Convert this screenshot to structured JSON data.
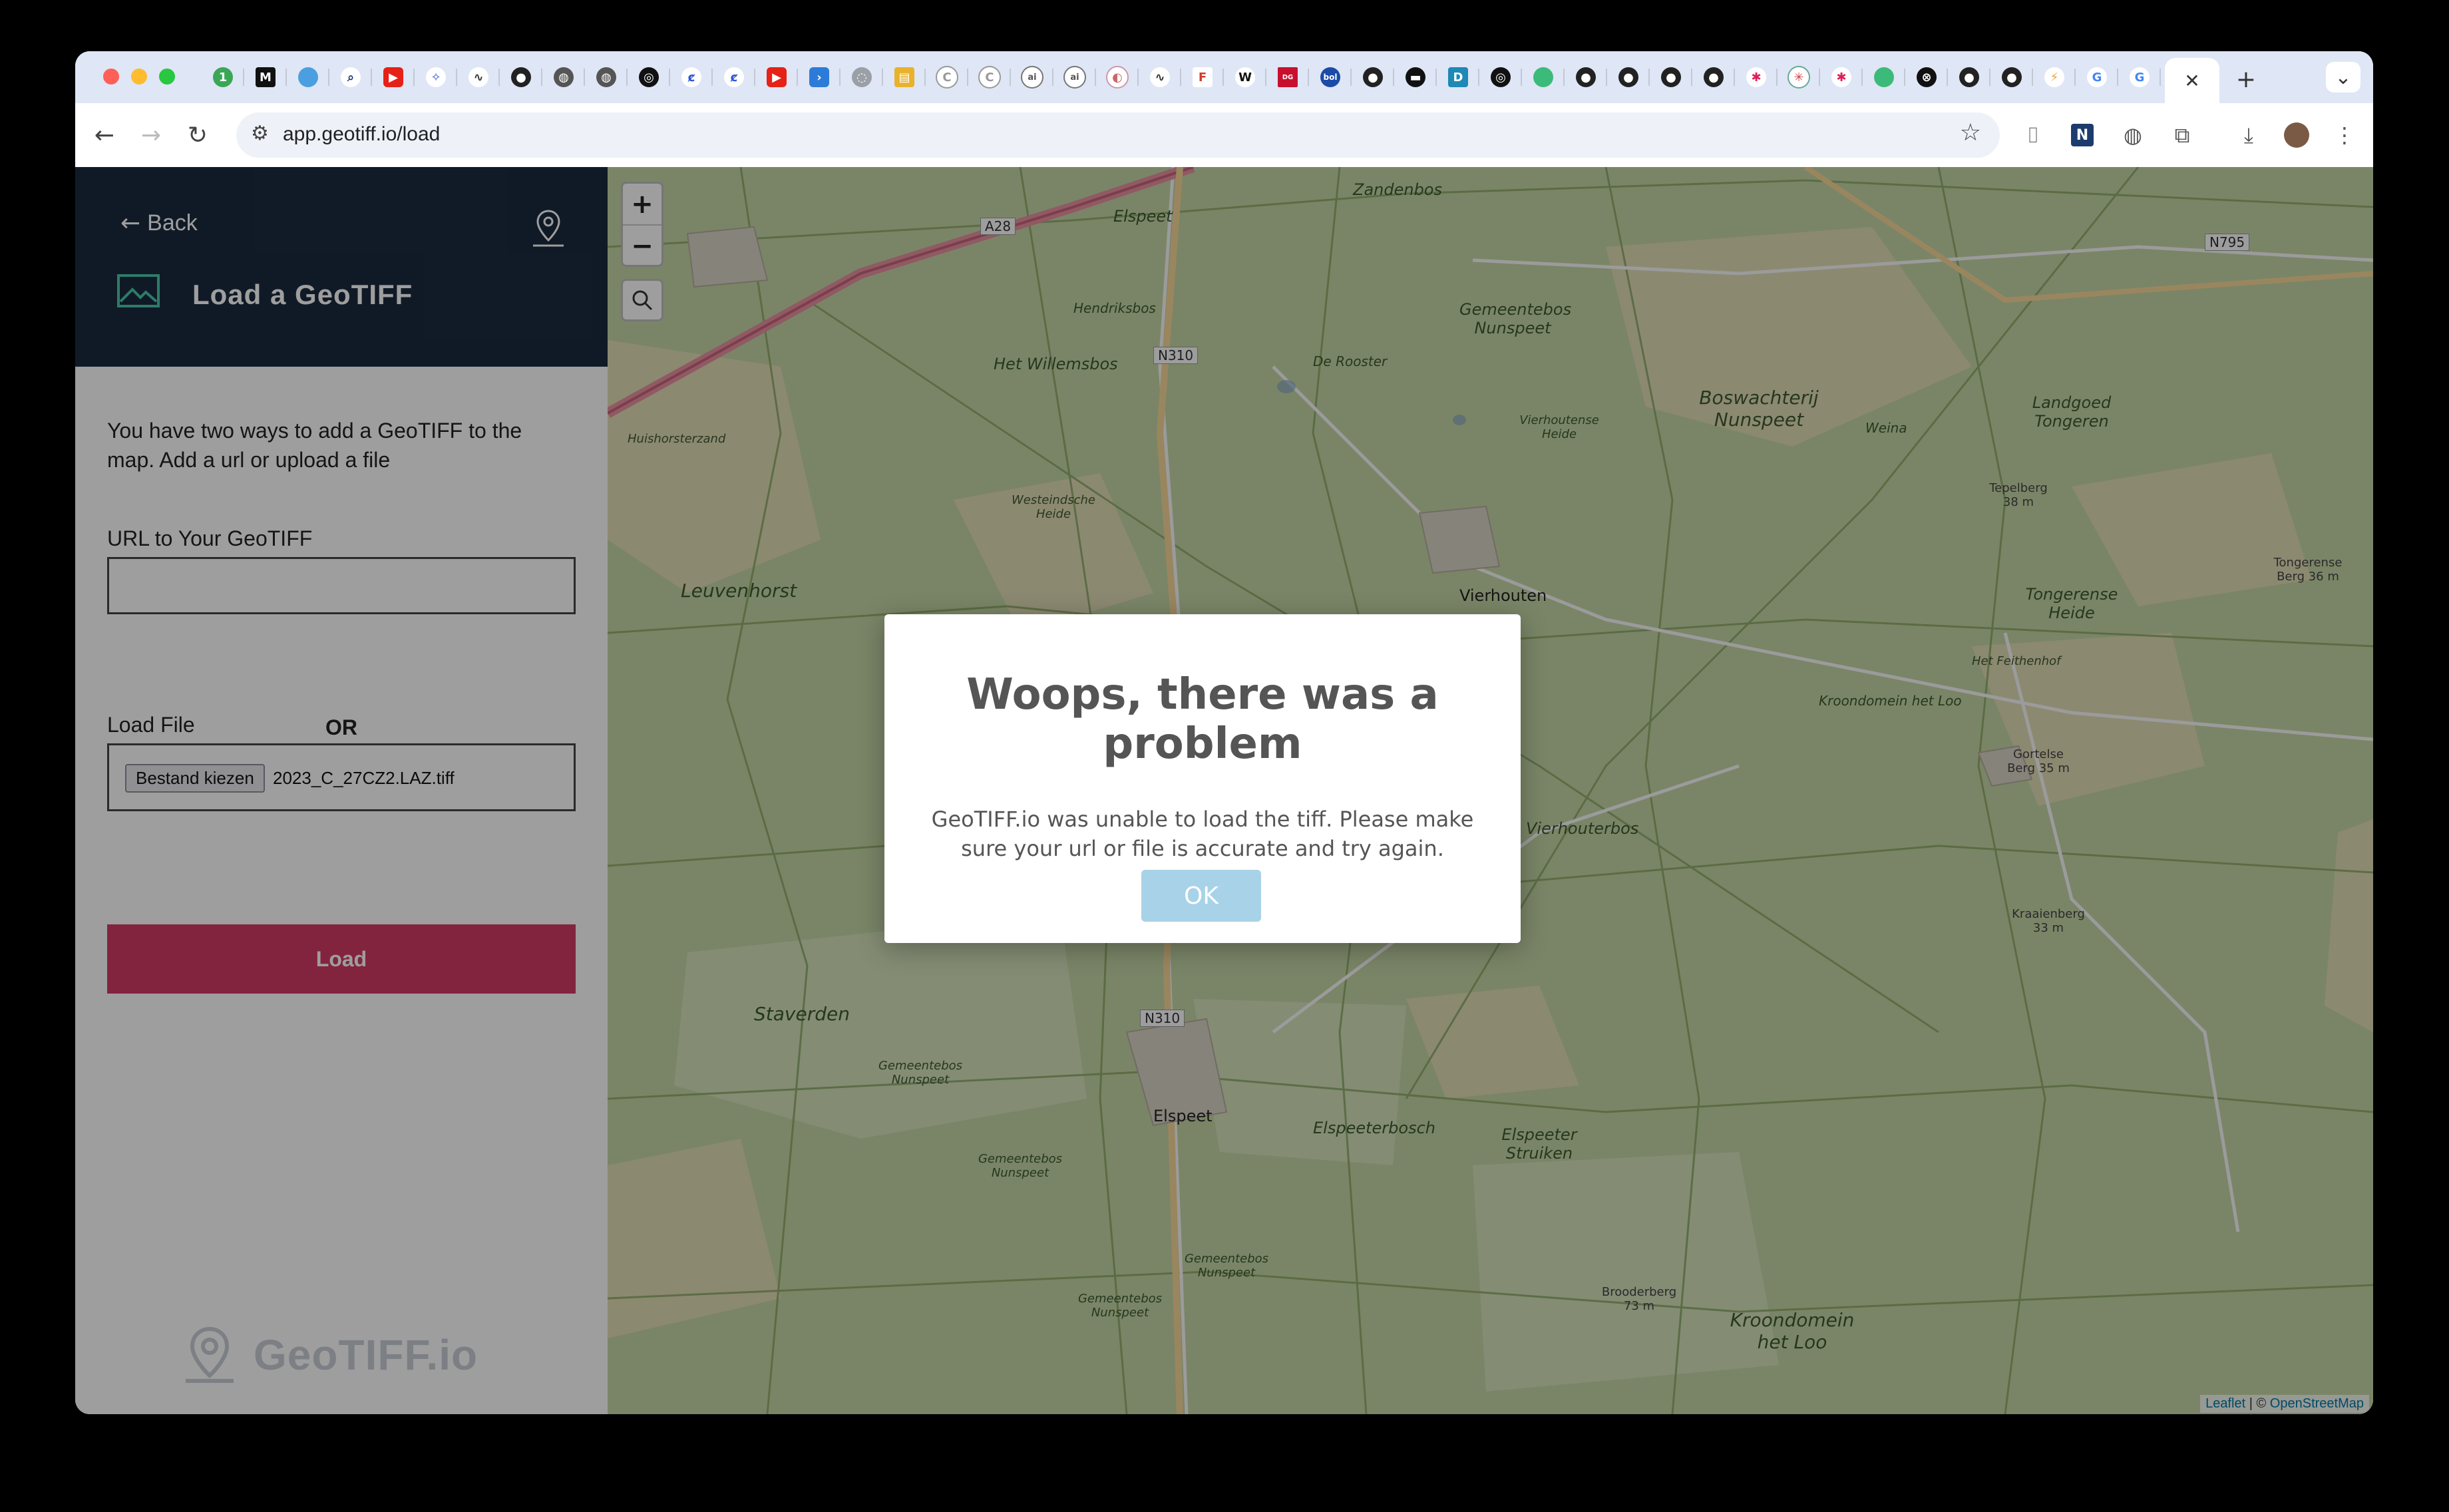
{
  "browser": {
    "url": "app.geotiff.io/load",
    "tab_close": "✕",
    "new_tab": "+",
    "tab_list": "⌄"
  },
  "sidebar": {
    "back_label": "Back",
    "title": "Load a GeoTIFF",
    "intro": "You have two ways to add a GeoTIFF to the map. Add a url or upload a file",
    "url_label": "URL to Your GeoTIFF",
    "url_value": "",
    "or_label": "OR",
    "file_label": "Load File",
    "file_button": "Bestand kiezen",
    "file_name": "2023_C_27CZ2.LAZ.tiff",
    "load_button": "Load",
    "brand": "GeoTIFF.io"
  },
  "map": {
    "zoom_in": "+",
    "zoom_out": "−",
    "attribution_leaflet": "Leaflet",
    "attribution_sep": " | © ",
    "attribution_osm": "OpenStreetMap",
    "labels": {
      "zandenbos": "Zandenbos",
      "elspeet_top": "Elspeet",
      "hendriksbos": "Hendriksbos",
      "het_willemsbos": "Het Willemsbos",
      "de_rooster": "De Rooster",
      "gemeentebos": "Gemeentebos Nunspeet",
      "boswachterij": "Boswachterij Nunspeet",
      "landgoed": "Landgoed Tongeren",
      "weina": "Weina",
      "tepelberg": "Tepelberg 38 m",
      "huishorsterzand": "Huishorsterzand",
      "westeindsche": "Westeindsche Heide",
      "vierhoutense_heide": "Vierhoutense Heide",
      "leuvenhorst": "Leuvenhorst",
      "vierhouten": "Vierhouten",
      "tongerense_heide": "Tongerense Heide",
      "tongerense_berg": "Tongerense Berg 36 m",
      "het_feithenhof": "Het Feithenhof",
      "kroondomein_top": "Kroondomein het Loo",
      "gortelse_berg": "Gortelse Berg 35 m",
      "vierhouterbos": "Vierhouterbos",
      "kraaienberg": "Kraaienberg 33 m",
      "staverden": "Staverden",
      "gemeentebos2": "Gemeentebos Nunspeet",
      "gemeentebos3": "Gemeentebos Nunspeet",
      "elspeet": "Elspeet",
      "elspeeterbosch": "Elspeeterbosch",
      "elspeeter_struiken": "Elspeeter Struiken",
      "gemeentebos4": "Gemeentebos Nunspeet",
      "gemeentebos5": "Gemeentebos Nunspeet",
      "brooderberg": "Brooderberg 73 m",
      "kroondomein": "Kroondomein het Loo"
    },
    "roads": {
      "a28": "A28",
      "n310_top": "N310",
      "n310_mid": "N310",
      "n795": "N795"
    }
  },
  "modal": {
    "title": "Woops, there was a problem",
    "message": "GeoTIFF.io was unable to load the tiff. Please make sure your url or file is accurate and try again.",
    "ok_button": "OK"
  }
}
